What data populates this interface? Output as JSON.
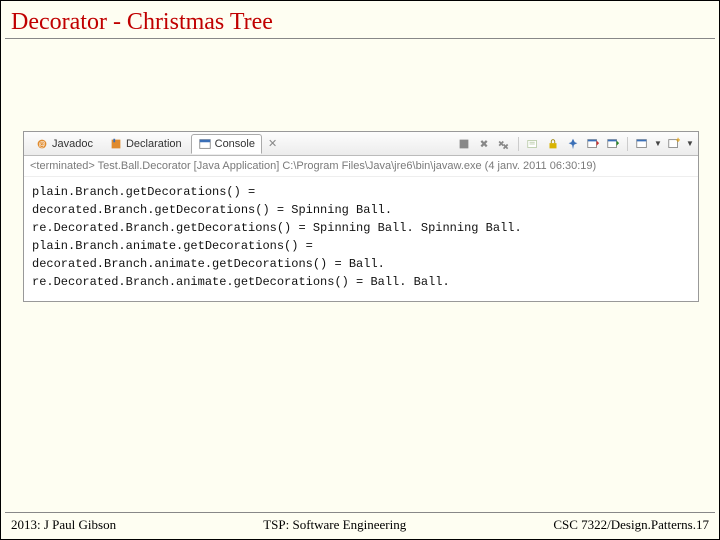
{
  "slide": {
    "title": "Decorator - Christmas Tree"
  },
  "tabs": {
    "javadoc": "Javadoc",
    "declaration": "Declaration",
    "console": "Console"
  },
  "terminated": "<terminated> Test.Ball.Decorator [Java Application] C:\\Program Files\\Java\\jre6\\bin\\javaw.exe (4 janv. 2011 06:30:19)",
  "console_lines": {
    "l0": "plain.Branch.getDecorations() = ",
    "l1": "decorated.Branch.getDecorations() = Spinning Ball. ",
    "l2": "re.Decorated.Branch.getDecorations() = Spinning Ball. Spinning Ball. ",
    "l3": "plain.Branch.animate.getDecorations() = ",
    "l4": "decorated.Branch.animate.getDecorations() = Ball. ",
    "l5": "re.Decorated.Branch.animate.getDecorations() = Ball. Ball. "
  },
  "footer": {
    "left": "2013: J Paul Gibson",
    "center": "TSP: Software Engineering",
    "right": "CSC 7322/Design.Patterns.17"
  }
}
